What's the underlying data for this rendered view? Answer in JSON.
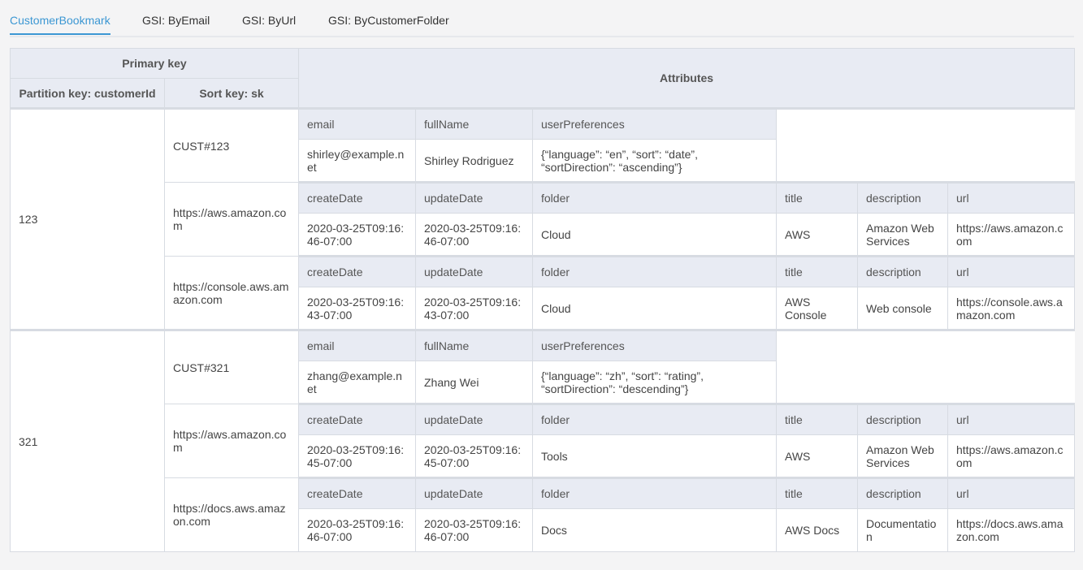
{
  "tabs": [
    {
      "label": "CustomerBookmark",
      "active": true
    },
    {
      "label": "GSI: ByEmail",
      "active": false
    },
    {
      "label": "GSI: ByUrl",
      "active": false
    },
    {
      "label": "GSI: ByCustomerFolder",
      "active": false
    }
  ],
  "colors": {
    "accent": "#3c97d3",
    "header_bg": "#e8ebf3",
    "border": "#d7dbe2"
  },
  "header": {
    "primary_key": "Primary key",
    "partition_key": "Partition key: customerId",
    "sort_key": "Sort key: sk",
    "attributes": "Attributes"
  },
  "customers": [
    {
      "id": "123",
      "profile": {
        "sk": "CUST#123",
        "headers": [
          "email",
          "fullName",
          "userPreferences"
        ],
        "values": [
          "shirley@example.net",
          "Shirley Rodriguez",
          "{“language”: “en”, “sort”: “date”, “sortDirection”: “ascending”}"
        ]
      },
      "bookmarks": [
        {
          "sk": "https://aws.amazon.com",
          "headers": [
            "createDate",
            "updateDate",
            "folder",
            "title",
            "description",
            "url"
          ],
          "values": [
            "2020-03-25T09:16:46-07:00",
            "2020-03-25T09:16:46-07:00",
            "Cloud",
            "AWS",
            "Amazon Web Services",
            "https://aws.amazon.com"
          ]
        },
        {
          "sk": "https://console.aws.amazon.com",
          "headers": [
            "createDate",
            "updateDate",
            "folder",
            "title",
            "description",
            "url"
          ],
          "values": [
            "2020-03-25T09:16:43-07:00",
            "2020-03-25T09:16:43-07:00",
            "Cloud",
            "AWS Console",
            "Web console",
            "https://console.aws.amazon.com"
          ]
        }
      ]
    },
    {
      "id": "321",
      "profile": {
        "sk": "CUST#321",
        "headers": [
          "email",
          "fullName",
          "userPreferences"
        ],
        "values": [
          "zhang@example.net",
          "Zhang Wei",
          "{“language”: “zh”, “sort”: “rating”, “sortDirection”: “descending”}"
        ]
      },
      "bookmarks": [
        {
          "sk": "https://aws.amazon.com",
          "headers": [
            "createDate",
            "updateDate",
            "folder",
            "title",
            "description",
            "url"
          ],
          "values": [
            "2020-03-25T09:16:45-07:00",
            "2020-03-25T09:16:45-07:00",
            "Tools",
            "AWS",
            "Amazon Web Services",
            "https://aws.amazon.com"
          ]
        },
        {
          "sk": "https://docs.aws.amazon.com",
          "headers": [
            "createDate",
            "updateDate",
            "folder",
            "title",
            "description",
            "url"
          ],
          "values": [
            "2020-03-25T09:16:46-07:00",
            "2020-03-25T09:16:46-07:00",
            "Docs",
            "AWS Docs",
            "Documentation",
            "https://docs.aws.amazon.com"
          ]
        }
      ]
    }
  ]
}
